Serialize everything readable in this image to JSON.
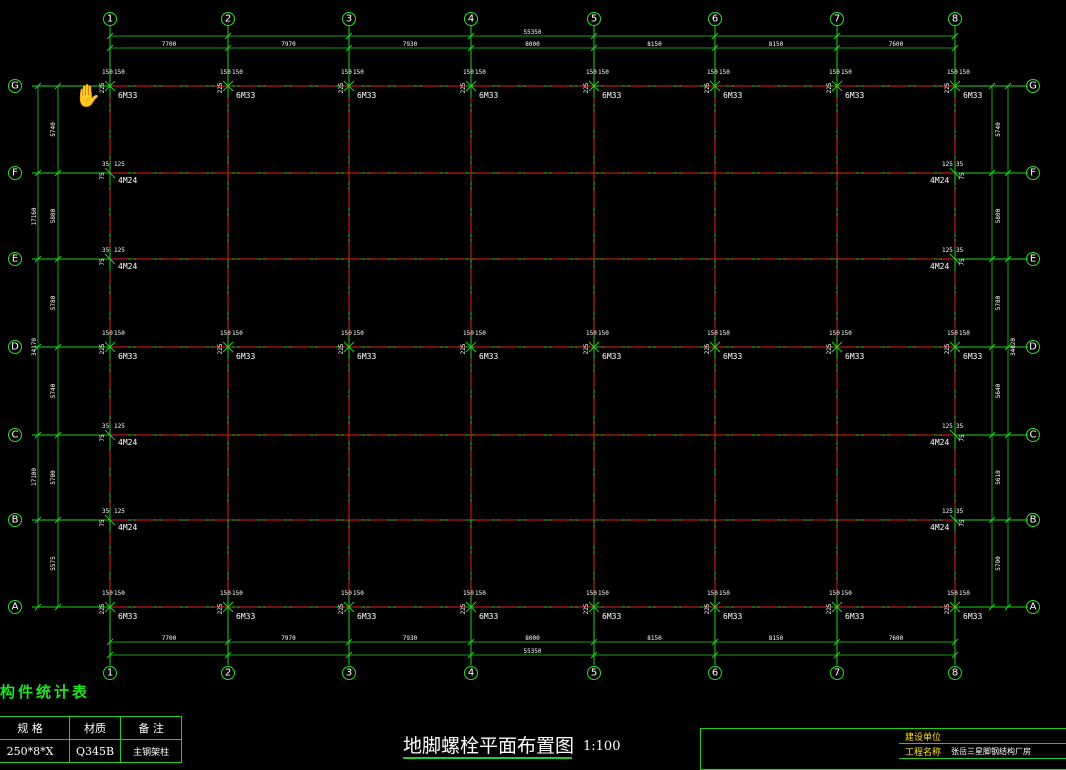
{
  "drawing": {
    "title": "地脚螺栓平面布置图",
    "scale": "1:100",
    "column_axes": [
      "1",
      "2",
      "3",
      "4",
      "5",
      "6",
      "7",
      "8"
    ],
    "row_axes": [
      "G",
      "F",
      "E",
      "D",
      "C",
      "B",
      "A"
    ],
    "top_total": "55350",
    "bottom_total": "55350",
    "top_spans": [
      "7700",
      "7970",
      "7930",
      "8000",
      "8150",
      "8150",
      "7600"
    ],
    "bottom_spans": [
      "7700",
      "7970",
      "7930",
      "8000",
      "8150",
      "8150",
      "7600"
    ],
    "left_total_top": "17160",
    "left_total_mid": "34170",
    "left_total_bottom": "17100",
    "left_spans": [
      "5740",
      "5800",
      "5780",
      "5740",
      "5700",
      "5575"
    ],
    "right_total": "34020",
    "right_spans": [
      "5740",
      "5800",
      "5780",
      "5640",
      "5610",
      "5790"
    ],
    "bolt_labels": {
      "main": "6M33",
      "side": "4M24",
      "offset_main": "150",
      "offset_side": "125",
      "side_small": "35",
      "gap_main": "225",
      "gap_side": "75"
    }
  },
  "stat_table": {
    "title": "构件统计表",
    "headers": [
      "规  格",
      "材质",
      "备  注"
    ],
    "row": [
      "250*8*X",
      "Q345B",
      "主钢架柱"
    ]
  },
  "title_block": {
    "row1_label": "建设单位",
    "row1_value": "",
    "row2_label": "工程名称",
    "row2_value": "张岳三星脚钢结构厂房"
  }
}
